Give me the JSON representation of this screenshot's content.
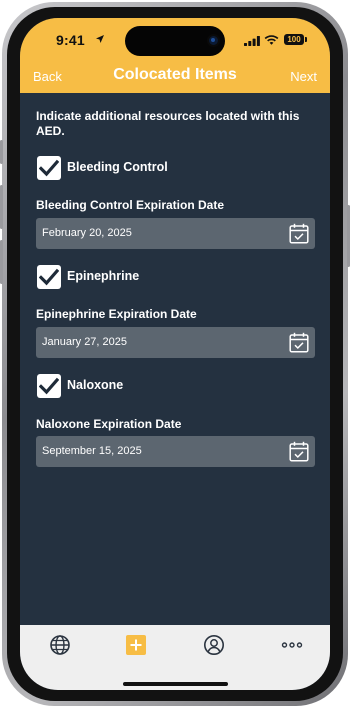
{
  "status_bar": {
    "time": "9:41",
    "battery": "100"
  },
  "nav": {
    "back_label": "Back",
    "title": "Colocated Items",
    "next_label": "Next"
  },
  "intro_text": "Indicate additional resources located with this AED.",
  "items": [
    {
      "label": "Bleeding Control",
      "checked": true,
      "date_label": "Bleeding Control Expiration Date",
      "date_value": "February 20, 2025"
    },
    {
      "label": "Epinephrine",
      "checked": true,
      "date_label": "Epinephrine Expiration Date",
      "date_value": "January 27, 2025"
    },
    {
      "label": "Naloxone",
      "checked": true,
      "date_label": "Naloxone Expiration Date",
      "date_value": "September 15, 2025"
    }
  ],
  "tabbar": {
    "icons": [
      "globe-icon",
      "add-icon",
      "profile-icon",
      "more-icon"
    ]
  },
  "colors": {
    "accent": "#f7bd45",
    "background": "#243140",
    "field": "#5c6670",
    "tabbar": "#efefef"
  }
}
